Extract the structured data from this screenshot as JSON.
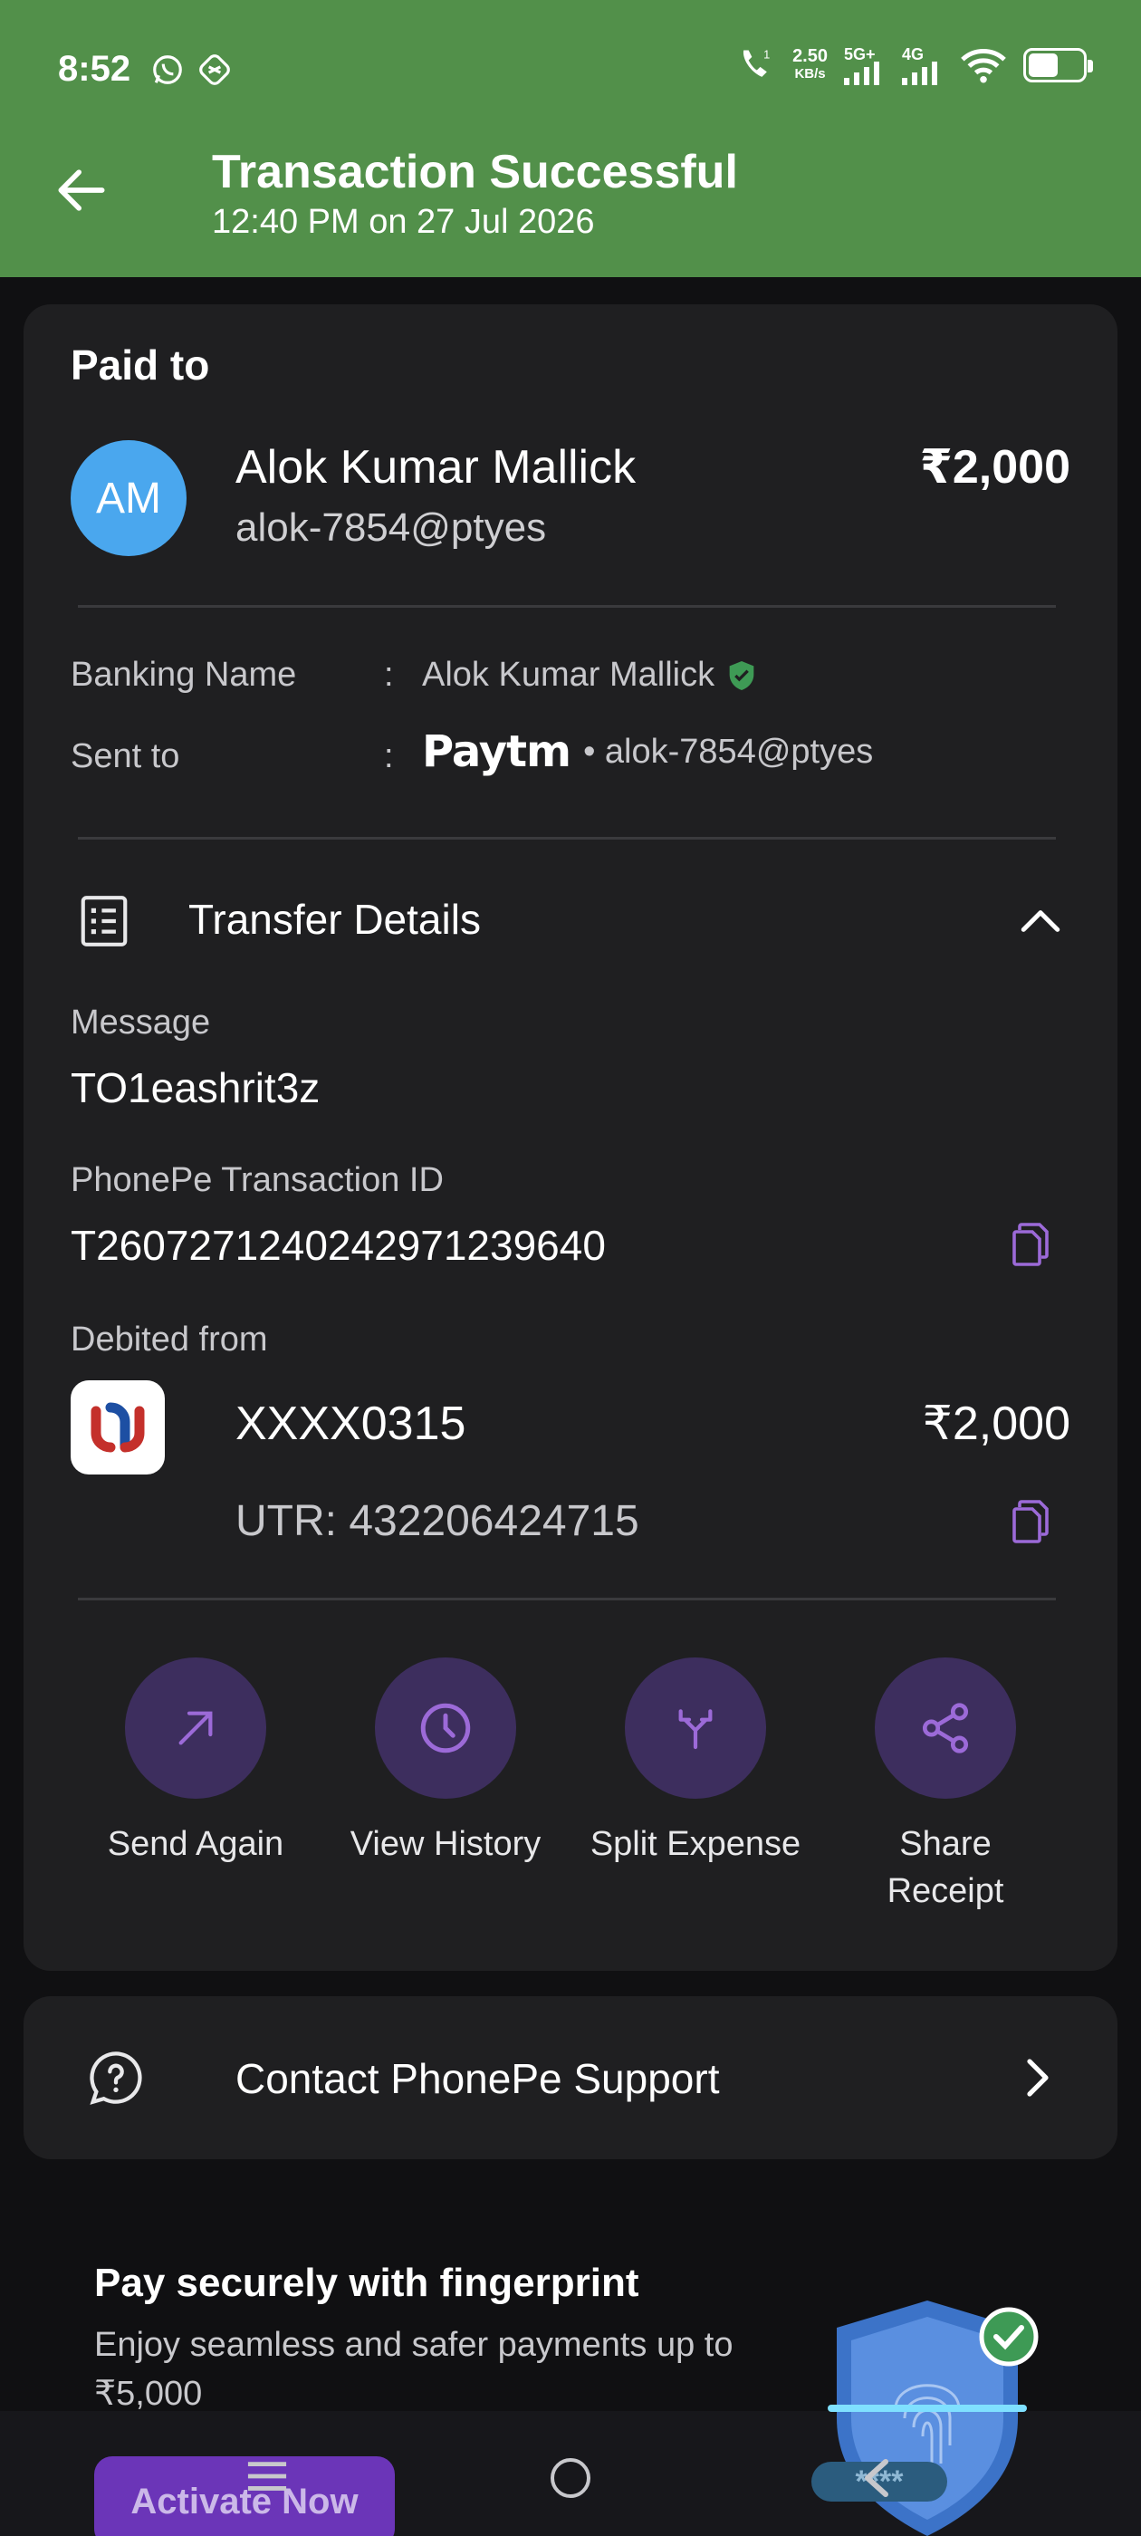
{
  "status_bar": {
    "time": "8:52",
    "net_speed_value": "2.50",
    "net_speed_unit": "KB/s",
    "net1": "5G+",
    "net2": "4G",
    "battery_percent": 55,
    "icons": [
      "whatsapp-icon",
      "sync-icon",
      "wifi-call-icon",
      "signal-icon",
      "wifi-icon",
      "battery-icon"
    ]
  },
  "header": {
    "title": "Transaction Successful",
    "subtitle": "12:40 PM on 27 Jul 2026",
    "bg_color": "#52904a"
  },
  "payment": {
    "paid_to_label": "Paid to",
    "avatar_initials": "AM",
    "payee_name": "Alok Kumar Mallick",
    "payee_upi": "alok-7854@ptyes",
    "amount": "₹2,000",
    "banking_name_label": "Banking Name",
    "banking_name": "Alok Kumar Mallick",
    "sent_to_label": "Sent to",
    "colon": ":",
    "sent_to_app": "Paytm",
    "sent_to_upi": "• alok-7854@ptyes"
  },
  "transfer": {
    "title": "Transfer Details",
    "message_label": "Message",
    "message": "TO1eashrit3z",
    "txn_id_label": "PhonePe Transaction ID",
    "txn_id": "T2607271240242971239640",
    "debited_label": "Debited from",
    "account": "XXXX0315",
    "account_amount": "₹2,000",
    "utr": "UTR: 432206424715"
  },
  "actions": [
    {
      "label": "Send Again",
      "icon": "arrow-up-right-icon"
    },
    {
      "label": "View History",
      "icon": "clock-icon"
    },
    {
      "label": "Split Expense",
      "icon": "split-icon"
    },
    {
      "label": "Share Receipt",
      "icon": "share-icon"
    }
  ],
  "support": {
    "label": "Contact PhonePe Support"
  },
  "promo": {
    "title": "Pay securely with fingerprint",
    "subtitle": "Enjoy seamless and safer payments up to ₹5,000",
    "button": "Activate Now",
    "shield_text": "****"
  },
  "colors": {
    "accent": "#9c6ad8",
    "action_bg": "#3d2e5e",
    "card_bg": "#1f1f21",
    "verified": "#3e9a55"
  }
}
